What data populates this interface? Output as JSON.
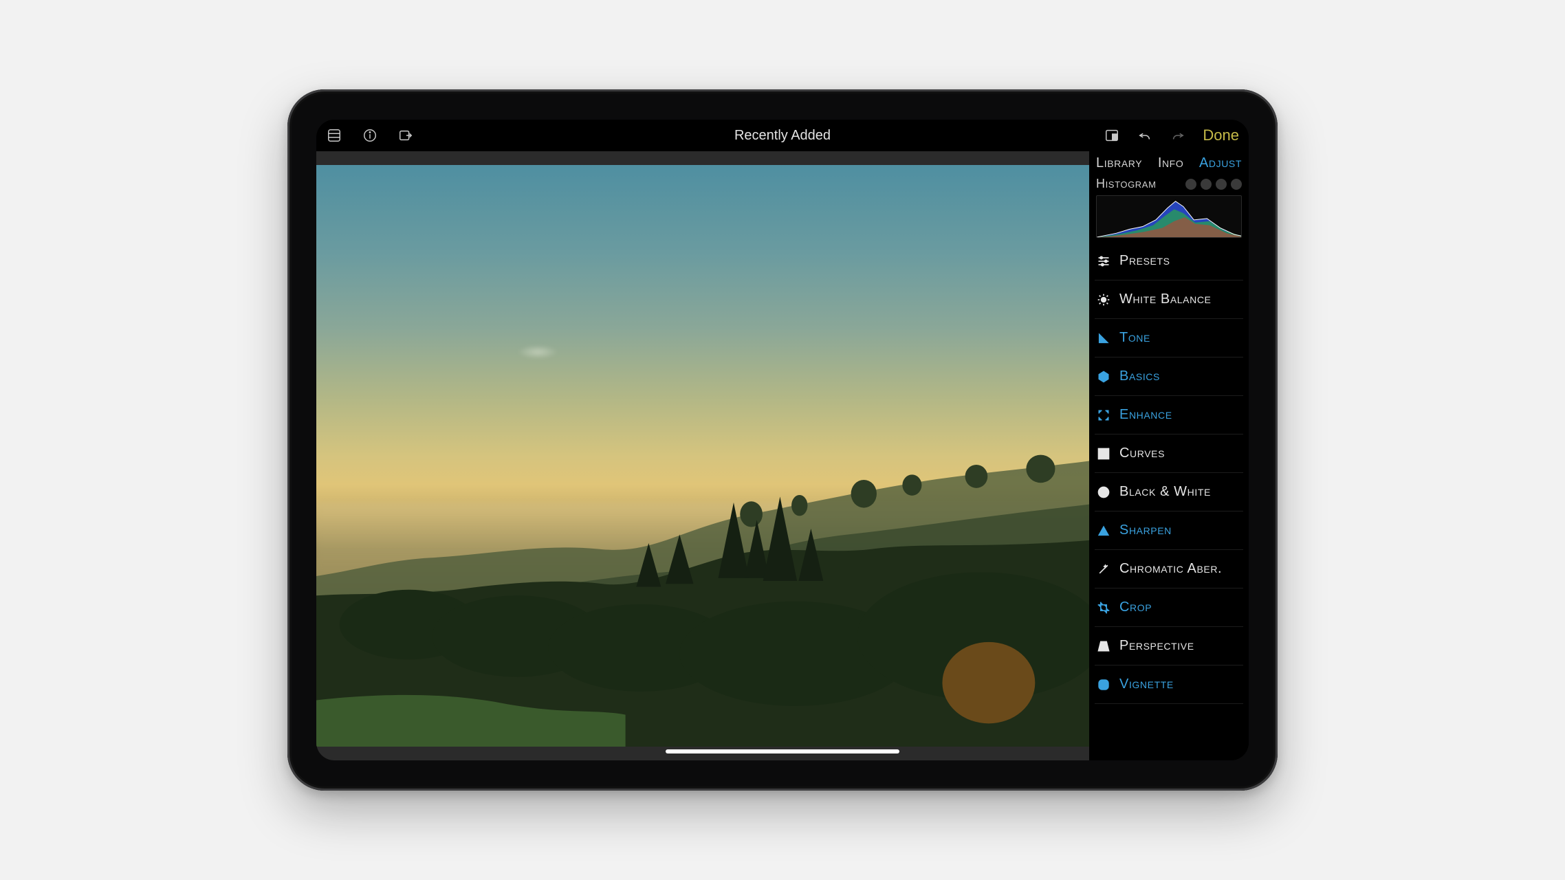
{
  "toolbar": {
    "title": "Recently Added",
    "done_label": "Done"
  },
  "panel": {
    "tabs": {
      "library": "Library",
      "info": "Info",
      "adjust": "Adjust",
      "active": "adjust"
    },
    "histogram_label": "Histogram",
    "items": [
      {
        "label": "Presets",
        "icon": "sliders",
        "active": false
      },
      {
        "label": "White Balance",
        "icon": "sun",
        "active": false
      },
      {
        "label": "Tone",
        "icon": "tone",
        "active": true
      },
      {
        "label": "Basics",
        "icon": "hexagon",
        "active": true
      },
      {
        "label": "Enhance",
        "icon": "expand",
        "active": true
      },
      {
        "label": "Curves",
        "icon": "curves",
        "active": false
      },
      {
        "label": "Black & White",
        "icon": "halfcircle",
        "active": false
      },
      {
        "label": "Sharpen",
        "icon": "triangle",
        "active": true
      },
      {
        "label": "Chromatic Aber.",
        "icon": "wand",
        "active": false
      },
      {
        "label": "Crop",
        "icon": "crop",
        "active": true
      },
      {
        "label": "Perspective",
        "icon": "perspective",
        "active": false
      },
      {
        "label": "Vignette",
        "icon": "roundsq",
        "active": true
      }
    ]
  },
  "colors": {
    "accent": "#3aa2e0",
    "done": "#c6bb48"
  }
}
